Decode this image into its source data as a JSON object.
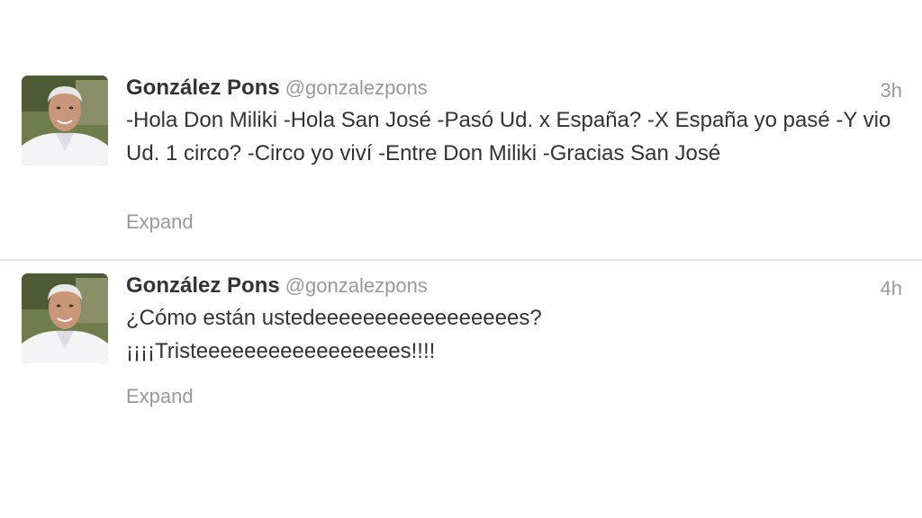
{
  "tweets": [
    {
      "name": "González Pons",
      "handle": "@gonzalezpons",
      "time": "3h",
      "text": "-Hola Don Miliki -Hola San José -Pasó Ud. x España? -X España yo pasé -Y vio Ud. 1 circo? -Circo yo viví -Entre Don Miliki -Gracias San José",
      "expand_label": "Expand",
      "avatar_icon": "profile-photo"
    },
    {
      "name": "González Pons",
      "handle": "@gonzalezpons",
      "time": "4h",
      "text_line1": "¿Cómo están ustedeeeeeeeeeeeeeeeees?",
      "text_line2": "¡¡¡¡Tristeeeeeeeeeeeeeeeees!!!!",
      "expand_label": "Expand",
      "avatar_icon": "profile-photo"
    }
  ],
  "colors": {
    "name": "#333333",
    "meta": "#999999",
    "divider": "#e6e6e6",
    "background": "#ffffff"
  }
}
